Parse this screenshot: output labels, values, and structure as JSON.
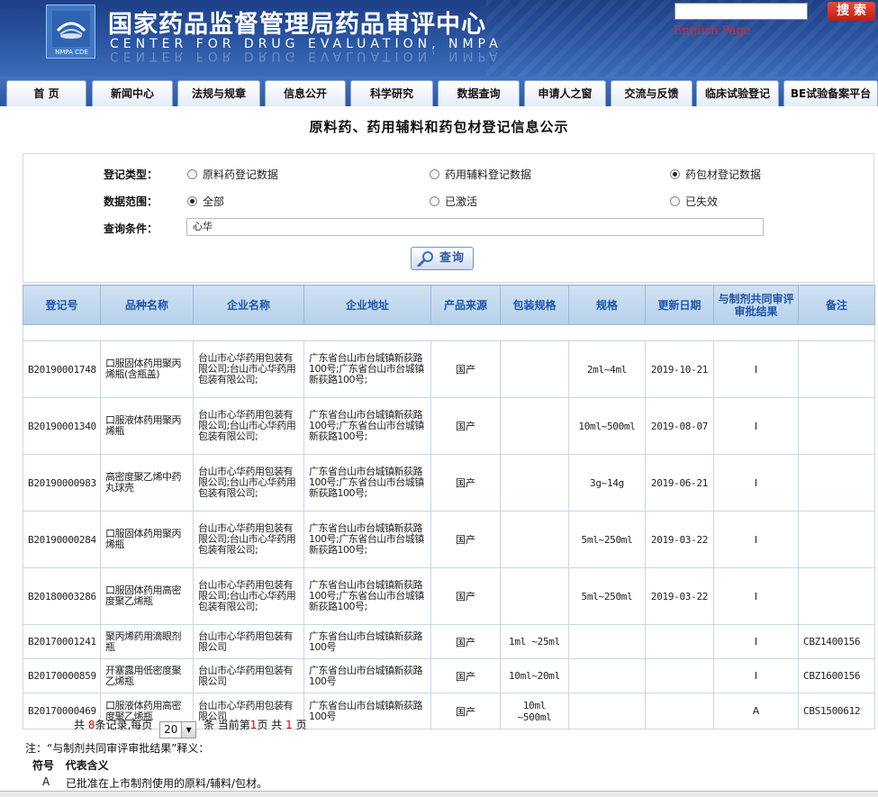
{
  "header": {
    "logo_text": "NMPA CDE",
    "title_cn": "国家药品监督管理局药品审评中心",
    "title_en": "CENTER  FOR  DRUG  EVALUATION,  NMPA",
    "search_placeholder": "",
    "search_button": "搜 索",
    "english_link": "English Page"
  },
  "nav": [
    "首  页",
    "新闻中心",
    "法规与规章",
    "信息公开",
    "科学研究",
    "数据查询",
    "申请人之窗",
    "交流与反馈",
    "临床试验登记",
    "BE试验备案平台"
  ],
  "page_title": "原料药、药用辅料和药包材登记信息公示",
  "query": {
    "type_label": "登记类型：",
    "type_options": [
      "原料药登记数据",
      "药用辅料登记数据",
      "药包材登记数据"
    ],
    "scope_label": "数据范围：",
    "scope_options": [
      "全部",
      "已激活",
      "已失效"
    ],
    "cond_label": "查询条件：",
    "cond_value": "心华",
    "button": "查询"
  },
  "table": {
    "headers": [
      "登记号",
      "品种名称",
      "企业名称",
      "企业地址",
      "产品来源",
      "包装规格",
      "规格",
      "更新日期",
      "与制剂共同审评审批结果",
      "备注"
    ],
    "rows": [
      [
        "B20190001748",
        "口服固体药用聚丙烯瓶(含瓶盖)",
        "台山市心华药用包装有限公司;台山市心华药用包装有限公司;",
        "广东省台山市台城镇新荻路100号;广东省台山市台城镇新荻路100号;",
        "国产",
        "",
        "2ml~4ml",
        "2019-10-21",
        "I",
        ""
      ],
      [
        "B20190001340",
        "口服液体药用聚丙烯瓶",
        "台山市心华药用包装有限公司;台山市心华药用包装有限公司;",
        "广东省台山市台城镇新荻路100号;广东省台山市台城镇新荻路100号;",
        "国产",
        "",
        "10ml~500ml",
        "2019-08-07",
        "I",
        ""
      ],
      [
        "B20190000983",
        "高密度聚乙烯中药丸球壳",
        "台山市心华药用包装有限公司;台山市心华药用包装有限公司;",
        "广东省台山市台城镇新荻路100号;广东省台山市台城镇新荻路100号;",
        "国产",
        "",
        "3g~14g",
        "2019-06-21",
        "I",
        ""
      ],
      [
        "B20190000284",
        "口服固体药用聚丙烯瓶",
        "台山市心华药用包装有限公司;台山市心华药用包装有限公司;",
        "广东省台山市台城镇新荻路100号;广东省台山市台城镇新荻路100号;",
        "国产",
        "",
        "5ml~250ml",
        "2019-03-22",
        "I",
        ""
      ],
      [
        "B20180003286",
        "口服固体药用高密度聚乙烯瓶",
        "台山市心华药用包装有限公司;台山市心华药用包装有限公司;",
        "广东省台山市台城镇新荻路100号;广东省台山市台城镇新荻路100号;",
        "国产",
        "",
        "5ml~250ml",
        "2019-03-22",
        "I",
        ""
      ],
      [
        "B20170001241",
        "聚丙烯药用滴眼剂瓶",
        "台山市心华药用包装有限公司",
        "广东省台山市台城镇新荻路100号",
        "国产",
        "1ml ~25ml",
        "",
        "",
        "I",
        "CBZ1400156"
      ],
      [
        "B20170000859",
        "开塞露用低密度聚乙烯瓶",
        "台山市心华药用包装有限公司",
        "广东省台山市台城镇新荻路100号",
        "国产",
        "10ml~20ml",
        "",
        "",
        "I",
        "CBZ1600156"
      ],
      [
        "B20170000469",
        "口服液体药用高密度聚乙烯瓶",
        "台山市心华药用包装有限公司",
        "广东省台山市台城镇新荻路100号",
        "国产",
        "10ml ~500ml",
        "",
        "",
        "A",
        "CBS1500612"
      ]
    ]
  },
  "pager": {
    "total_prefix": "共",
    "total": "8",
    "total_suffix": "条记录,每页",
    "page_size": "20",
    "current_prefix": "条 当前第",
    "current": "1",
    "current_suffix": "页 共",
    "pages": "1",
    "pages_suffix": "页"
  },
  "notes": {
    "title": "注：“与制剂共同审评审批结果”释义：",
    "head_symbol": "符号",
    "head_meaning": "代表含义",
    "row_symbol": "A",
    "row_meaning": "已批准在上市制剂使用的原料/辅料/包材。"
  }
}
